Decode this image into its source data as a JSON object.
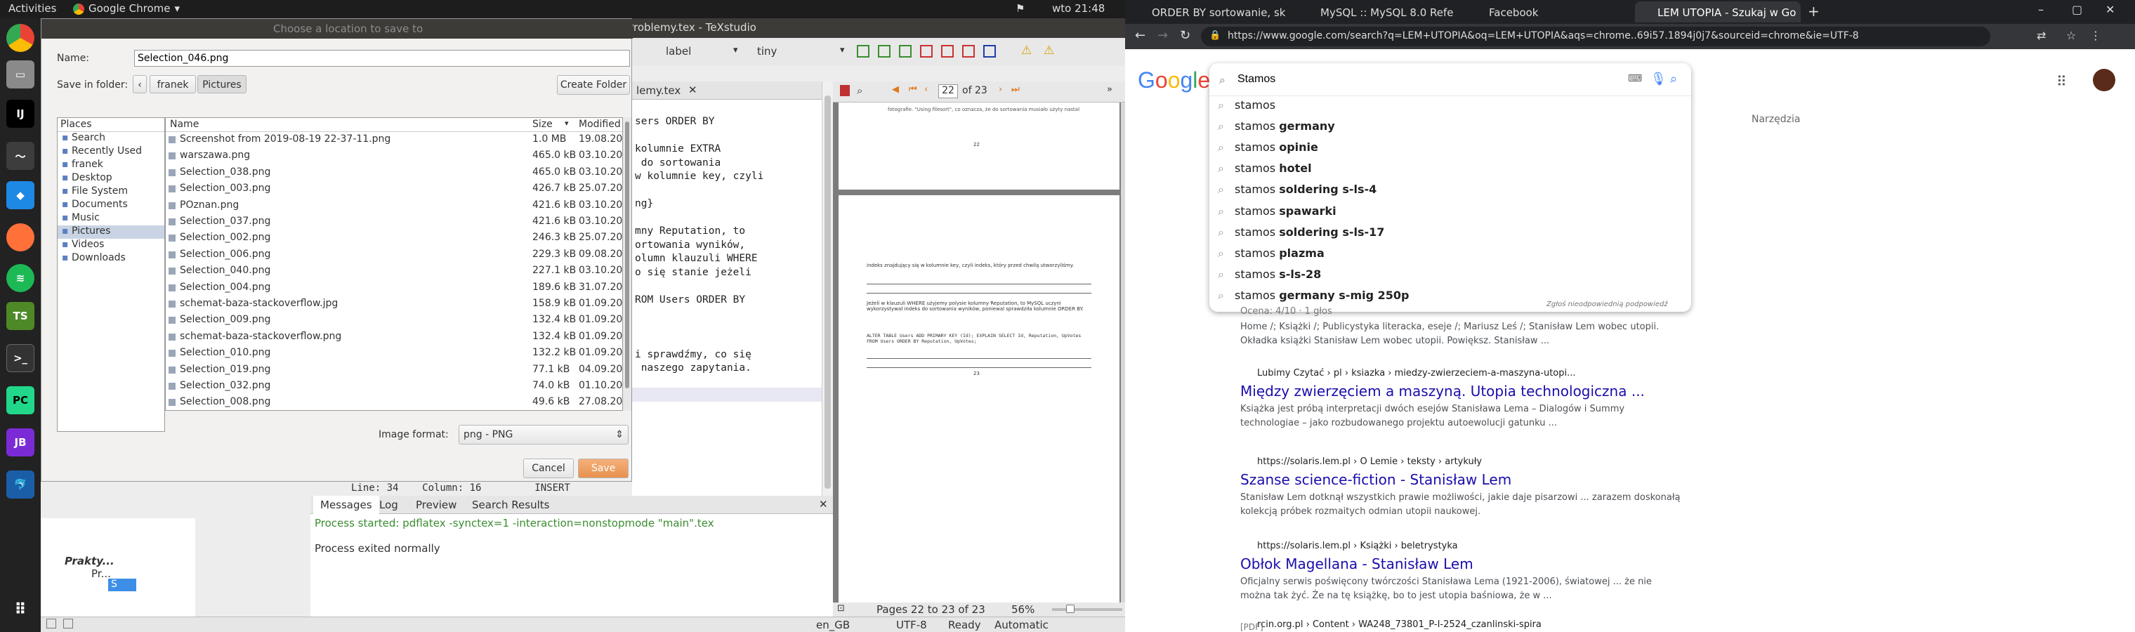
{
  "topbar": {
    "activities": "Activities",
    "app": "Google Chrome",
    "clock": "wto 21:48"
  },
  "dock": {
    "icons": [
      "chrome-icon",
      "files-icon",
      "intellij-icon",
      "monitor-icon",
      "pycharm-icon",
      "firefox-icon",
      "spotify-icon",
      "texstudio-icon",
      "terminal-icon",
      "pycharm-pro-icon",
      "jetbrains-icon",
      "mysql-icon",
      "apps-grid-icon"
    ]
  },
  "texstudio": {
    "window_title": "eProblemy.tex - TeXstudio",
    "editor_tab": "lemy.tex",
    "toolbar": {
      "label_select": "label",
      "size_select": "tiny"
    },
    "editor_lines": [
      "sers ORDER BY",
      "",
      "kolumnie EXTRA",
      " do sortowania",
      "w kolumnie key, czyli",
      "",
      "ng}",
      "",
      "mny Reputation, to",
      "ortowania wyników,",
      "olumn klauzuli WHERE",
      "o się stanie jeżeli",
      "",
      "ROM Users ORDER BY",
      "",
      "",
      "",
      "i sprawdźmy, co się",
      " naszego zapytania.",
      "",
      "ROM Users ORDER BY"
    ],
    "cursor_status": "Line: 34    Column: 16         INSERT",
    "pdf": {
      "page": "22",
      "of": "of 23",
      "footer_pages": "Pages 22 to 23 of 23",
      "zoom": "56%",
      "page_num_top": "22",
      "page_num_bottom": "23",
      "snippet_top": "fotografie. \"Using filesort\", co oznacza, że do sortowania musiało użyty nastal",
      "para1": "indeks znajdujący się w kolumnie key, czyli indeks, który przed chwilą utworzyliśmy.",
      "para2": "Jeżeli w klauzuli WHERE użyjemy polysie kolumny Reputation, to MySQL uczyni wykorzystywał indeks do sortowania wyników, poniewal sprawdziła kolumnie ORDER BY.",
      "code": "ALTER TABLE Users ADD PRIMARY KEY (Id); EXPLAIN SELECT Id, Reputation, UpVotes FROM Users ORDER BY Reputation, UpVotes;"
    },
    "bottom_tabs": [
      "Messages",
      "Log",
      "Preview",
      "Search Results"
    ],
    "messages": [
      "Process started: pdflatex -synctex=1 -interaction=nonstopmode \"main\".tex",
      "Process exited normally"
    ],
    "structure": {
      "root": "Prakty...",
      "child": "Pr...",
      "leaf": "S"
    },
    "statusbar": {
      "lang": "en_GB",
      "encoding": "UTF-8",
      "state": "Ready",
      "mode": "Automatic"
    }
  },
  "dialog": {
    "title": "Choose a location to save to",
    "name_label": "Name:",
    "name_value": "Selection_046.png",
    "save_in_label": "Save in folder:",
    "crumbs": [
      "franek",
      "Pictures"
    ],
    "create_folder": "Create Folder",
    "places_header": "Places",
    "places": [
      "Search",
      "Recently Used",
      "franek",
      "Desktop",
      "File System",
      "Documents",
      "Music",
      "Pictures",
      "Videos",
      "Downloads"
    ],
    "columns": [
      "Name",
      "Size",
      "Modified"
    ],
    "files": [
      [
        "Screenshot from 2019-08-19 22-37-11.png",
        "1.0 MB",
        "19.08.2019"
      ],
      [
        "warszawa.png",
        "465.0 kB",
        "03.10.2019"
      ],
      [
        "Selection_038.png",
        "465.0 kB",
        "03.10.2019"
      ],
      [
        "Selection_003.png",
        "426.7 kB",
        "25.07.2019"
      ],
      [
        "POznan.png",
        "421.6 kB",
        "03.10.2019"
      ],
      [
        "Selection_037.png",
        "421.6 kB",
        "03.10.2019"
      ],
      [
        "Selection_002.png",
        "246.3 kB",
        "25.07.2019"
      ],
      [
        "Selection_006.png",
        "229.3 kB",
        "09.08.2019"
      ],
      [
        "Selection_040.png",
        "227.1 kB",
        "03.10.2019"
      ],
      [
        "Selection_004.png",
        "189.6 kB",
        "31.07.2019"
      ],
      [
        "schemat-baza-stackoverflow.jpg",
        "158.9 kB",
        "01.09.2019"
      ],
      [
        "Selection_009.png",
        "132.4 kB",
        "01.09.2019"
      ],
      [
        "schemat-baza-stackoverflow.png",
        "132.4 kB",
        "01.09.2019"
      ],
      [
        "Selection_010.png",
        "132.2 kB",
        "01.09.2019"
      ],
      [
        "Selection_019.png",
        "77.1 kB",
        "04.09.2019"
      ],
      [
        "Selection_032.png",
        "74.0 kB",
        "01.10.2019"
      ],
      [
        "Selection_008.png",
        "49.6 kB",
        "27.08.2019"
      ]
    ],
    "format_label": "Image format:",
    "format_value": "png - PNG",
    "cancel": "Cancel",
    "save": "Save"
  },
  "chrome": {
    "tabs": [
      "ORDER BY sortowanie, sk",
      "MySQL :: MySQL 8.0 Refe",
      "Facebook",
      "LEM UTOPIA - Szukaj w Go"
    ],
    "url": "https://www.google.com/search?q=LEM+UTOPIA&oq=LEM+UTOPIA&aqs=chrome..69i57.1894j0j7&sourceid=chrome&ie=UTF-8",
    "logo": [
      "G",
      "o",
      "o",
      "g",
      "l",
      "e"
    ],
    "search_value": "Stamos",
    "suggestions": [
      [
        "stamos",
        ""
      ],
      [
        "stamos ",
        "germany"
      ],
      [
        "stamos ",
        "opinie"
      ],
      [
        "stamos ",
        "hotel"
      ],
      [
        "stamos ",
        "soldering s-ls-4"
      ],
      [
        "stamos ",
        "spawarki"
      ],
      [
        "stamos ",
        "soldering s-ls-17"
      ],
      [
        "stamos ",
        "plazma"
      ],
      [
        "stamos ",
        "s-ls-28"
      ],
      [
        "stamos ",
        "germany s-mig 250p"
      ]
    ],
    "report": "Zgłoś nieodpowiednią podpowiedź",
    "tools": "Narzędzia",
    "results": [
      {
        "crumb": "",
        "title": "",
        "snippet1": "Home /; Książki /; Publicystyka literacka, eseje /; Mariusz Leś /; Stanisław Lem wobec utopii.",
        "snippet2": "Okładka książki Stanisław Lem wobec utopii. Powiększ. Stanisław ..."
      },
      {
        "crumb": "Lubimy Czytać › pl › ksiazka › miedzy-zwierzeciem-a-maszyna-utopi...",
        "title": "Między zwierzęciem a maszyną. Utopia technologiczna ...",
        "snippet1": "Książka jest próbą interpretacji dwóch esejów Stanisława Lema – Dialogów i Summy",
        "snippet2": "technologiae – jako rozbudowanego projektu autoewolucji gatunku ..."
      },
      {
        "crumb": "https://solaris.lem.pl › O Lemie › teksty › artykuły",
        "title": "Szanse science-fiction - Stanisław Lem",
        "snippet1": "Stanisław Lem dotknął wszystkich prawie możliwości, jakie daje pisarzowi ... zarazem doskonałą",
        "snippet2": "kolekcją próbek rozmaitych odmian utopii naukowej."
      },
      {
        "crumb": "https://solaris.lem.pl › Książki › beletrystyka",
        "title": "Obłok Magellana - Stanisław Lem",
        "snippet1": "Oficjalny serwis poświęcony twórczości Stanisława Lema (1921-2006), światowej ... że nie",
        "snippet2": "można tak żyć. Że na tę książkę, bo to jest utopia baśniowa, że w ..."
      },
      {
        "crumb": "rcin.org.pl › Content › WA248_73801_P-I-2524_czanlinski-spira",
        "title": "",
        "snippet1": "",
        "snippet2": ""
      }
    ],
    "rating_line": "Ocena: 4/10 · 1 głos",
    "pdf_tag": "[PDF]"
  },
  "colors": {
    "google_blue": "#4285f4",
    "google_red": "#ea4335",
    "google_yellow": "#fbbc05",
    "google_green": "#34a853",
    "link": "#1a0dab",
    "green_msg": "#3a8d2f"
  }
}
